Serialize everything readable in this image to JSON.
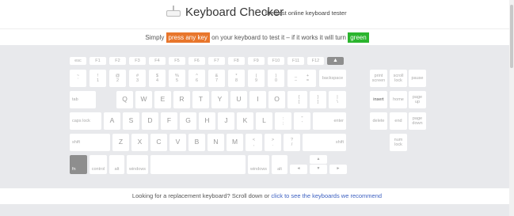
{
  "header": {
    "title": "Keyboard Checker",
    "tagline": "the best online keyboard tester"
  },
  "instructions": {
    "part1": "Simply ",
    "highlight1": "press any key",
    "part2": " on your keyboard to test it – if it works it will turn ",
    "highlight2": "green",
    "colors": {
      "orange": "#e8762c",
      "green": "#2bb52e"
    }
  },
  "keyboard": {
    "function_row": [
      "esc",
      "F1",
      "F2",
      "F3",
      "F4",
      "F5",
      "F6",
      "F7",
      "F8",
      "F9",
      "F10",
      "F11",
      "F12",
      "▲"
    ],
    "number_row": [
      {
        "top": "~",
        "bottom": "`"
      },
      {
        "top": "!",
        "bottom": "1"
      },
      {
        "top": "@",
        "bottom": "2"
      },
      {
        "top": "#",
        "bottom": "3"
      },
      {
        "top": "$",
        "bottom": "4"
      },
      {
        "top": "%",
        "bottom": "5"
      },
      {
        "top": "^",
        "bottom": "6"
      },
      {
        "top": "&",
        "bottom": "7"
      },
      {
        "top": "*",
        "bottom": "8"
      },
      {
        "top": "(",
        "bottom": "9"
      },
      {
        "top": ")",
        "bottom": "0"
      },
      {
        "top": "_",
        "bottom": "–"
      },
      {
        "top": "+",
        "bottom": "="
      },
      {
        "top": "",
        "bottom": "backspace"
      }
    ],
    "qwerty_row": [
      "tab",
      "Q",
      "W",
      "E",
      "R",
      "T",
      "Y",
      "U",
      "I",
      "O",
      "P"
    ],
    "qwerty_brackets": [
      {
        "top": "{",
        "bottom": "["
      },
      {
        "top": "}",
        "bottom": "]"
      },
      {
        "top": "|",
        "bottom": "\\"
      }
    ],
    "home_row": [
      "caps lock",
      "A",
      "S",
      "D",
      "F",
      "G",
      "H",
      "J",
      "K",
      "L"
    ],
    "home_punct": [
      {
        "top": ":",
        "bottom": ";"
      },
      {
        "top": "\"",
        "bottom": "'"
      }
    ],
    "home_enter": "enter",
    "shift_row": [
      "shift",
      "Z",
      "X",
      "C",
      "V",
      "B",
      "N",
      "M"
    ],
    "shift_punct": [
      {
        "top": "<",
        "bottom": ","
      },
      {
        "top": ">",
        "bottom": "."
      },
      {
        "top": "?",
        "bottom": "/"
      }
    ],
    "shift_right": "shift",
    "bottom_row": [
      "fn",
      "control",
      "alt",
      "windows",
      "",
      "windows",
      "alt"
    ],
    "arrows": {
      "left": "◄",
      "up": "▲",
      "down": "▼",
      "right": "►"
    },
    "nav_cluster": {
      "row1": [
        {
          "top": "print",
          "bottom": "screen"
        },
        {
          "top": "scroll",
          "bottom": "lock"
        },
        {
          "top": "pause",
          "bottom": ""
        }
      ],
      "row2": [
        {
          "top": "insert",
          "bottom": ""
        },
        {
          "top": "home",
          "bottom": ""
        },
        {
          "top": "page",
          "bottom": "up"
        }
      ],
      "row3": [
        {
          "top": "delete",
          "bottom": ""
        },
        {
          "top": "end",
          "bottom": ""
        },
        {
          "top": "page",
          "bottom": "down"
        }
      ],
      "numlock": {
        "top": "num",
        "bottom": "lock"
      }
    }
  },
  "footer": {
    "text": "Looking for a replacement keyboard? Scroll down or ",
    "link": "click to see the keyboards we recommend"
  }
}
